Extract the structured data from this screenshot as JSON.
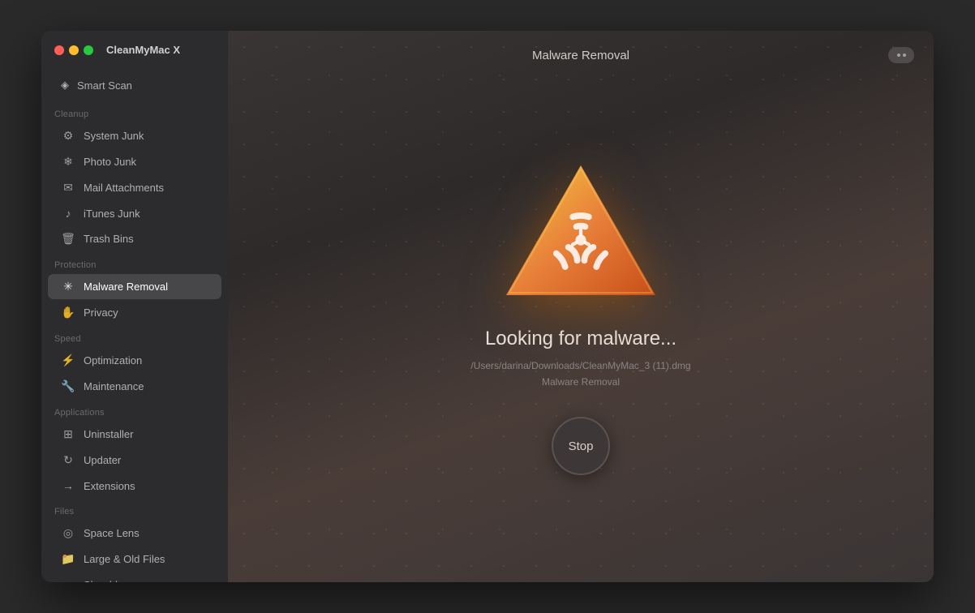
{
  "window": {
    "title": "CleanMyMac X",
    "main_title": "Malware Removal"
  },
  "sidebar": {
    "smart_scan_label": "Smart Scan",
    "sections": [
      {
        "label": "Cleanup",
        "items": [
          {
            "id": "system-junk",
            "label": "System Junk",
            "icon": "⚙"
          },
          {
            "id": "photo-junk",
            "label": "Photo Junk",
            "icon": "❄"
          },
          {
            "id": "mail-attachments",
            "label": "Mail Attachments",
            "icon": "✉"
          },
          {
            "id": "itunes-junk",
            "label": "iTunes Junk",
            "icon": "♪"
          },
          {
            "id": "trash-bins",
            "label": "Trash Bins",
            "icon": "🗑"
          }
        ]
      },
      {
        "label": "Protection",
        "items": [
          {
            "id": "malware-removal",
            "label": "Malware Removal",
            "icon": "✳",
            "active": true
          },
          {
            "id": "privacy",
            "label": "Privacy",
            "icon": "✋"
          }
        ]
      },
      {
        "label": "Speed",
        "items": [
          {
            "id": "optimization",
            "label": "Optimization",
            "icon": "⚡"
          },
          {
            "id": "maintenance",
            "label": "Maintenance",
            "icon": "🔧"
          }
        ]
      },
      {
        "label": "Applications",
        "items": [
          {
            "id": "uninstaller",
            "label": "Uninstaller",
            "icon": "⊞"
          },
          {
            "id": "updater",
            "label": "Updater",
            "icon": "↻"
          },
          {
            "id": "extensions",
            "label": "Extensions",
            "icon": "→"
          }
        ]
      },
      {
        "label": "Files",
        "items": [
          {
            "id": "space-lens",
            "label": "Space Lens",
            "icon": "◎"
          },
          {
            "id": "large-old-files",
            "label": "Large & Old Files",
            "icon": "📁"
          },
          {
            "id": "shredder",
            "label": "Shredder",
            "icon": "≡"
          }
        ]
      }
    ]
  },
  "main": {
    "status_text": "Looking for malware...",
    "scan_path": "/Users/darina/Downloads/CleanMyMac_3 (11).dmg",
    "scan_category": "Malware Removal",
    "stop_button_label": "Stop"
  }
}
